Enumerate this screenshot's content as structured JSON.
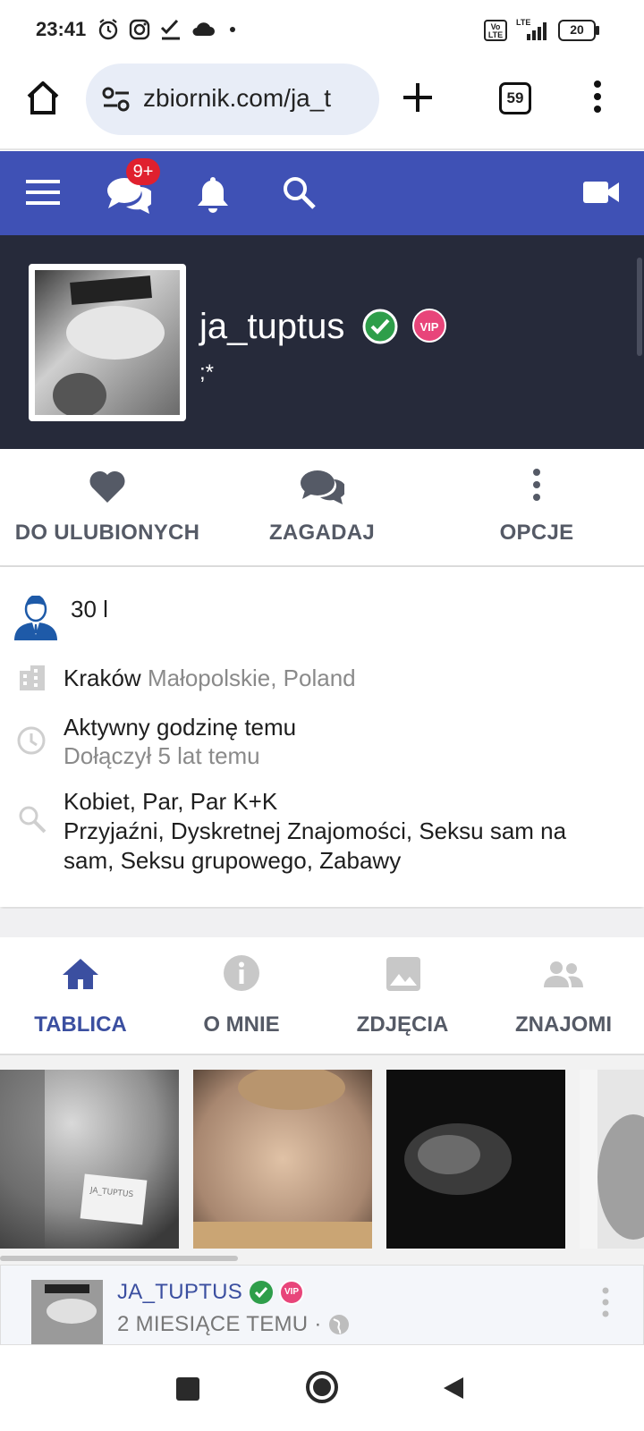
{
  "status_bar": {
    "time": "23:41",
    "battery": "20",
    "icons": [
      "alarm-icon",
      "instagram-icon",
      "check-icon",
      "cloud-icon",
      "dot-icon",
      "volte-icon",
      "signal-icon",
      "battery-icon"
    ],
    "volte_label": "Vo\nLTE",
    "lte_label": "LTE"
  },
  "browser": {
    "url": "zbiornik.com/ja_t",
    "tab_count": "59"
  },
  "site_nav": {
    "messages_badge": "9+"
  },
  "profile": {
    "username": "ja_tuptus",
    "status": ";*",
    "vip_label": "VIP"
  },
  "actions": [
    {
      "label": "DO ULUBIONYCH",
      "icon": "heart-icon"
    },
    {
      "label": "ZAGADAJ",
      "icon": "chat-icon"
    },
    {
      "label": "OPCJE",
      "icon": "more-vertical-icon"
    }
  ],
  "info": {
    "age": "30 l",
    "city": "Kraków",
    "region": "Małopolskie, Poland",
    "active": "Aktywny godzinę temu",
    "joined": "Dołączył 5 lat temu",
    "looking_for": "Kobiet, Par, Par K+K",
    "interests_line1": "Przyjaźni, Dyskretnej Znajomości, Seksu sam na",
    "interests_line2": "sam, Seksu grupowego, Zabawy"
  },
  "tabs": [
    {
      "label": "TABLICA",
      "icon": "home-icon",
      "active": true
    },
    {
      "label": "O MNIE",
      "icon": "info-icon",
      "active": false
    },
    {
      "label": "ZDJĘCIA",
      "icon": "image-icon",
      "active": false
    },
    {
      "label": "ZNAJOMI",
      "icon": "people-icon",
      "active": false
    }
  ],
  "gallery": {
    "photos": [
      "photo-1",
      "photo-2",
      "photo-3",
      "photo-4"
    ],
    "verification_card_text": "JA_TUPTUS\nzbiornik.com\n20.03.2019"
  },
  "post": {
    "author": "JA_TUPTUS",
    "time": "2 MIESIĄCE TEMU ·"
  },
  "colors": {
    "nav_blue": "#3f51b5",
    "header_dark": "#262a3a",
    "verified_green": "#2e9e4a",
    "vip_pink": "#e8457a",
    "badge_red": "#e0202e",
    "tab_active": "#3b4fa0"
  }
}
